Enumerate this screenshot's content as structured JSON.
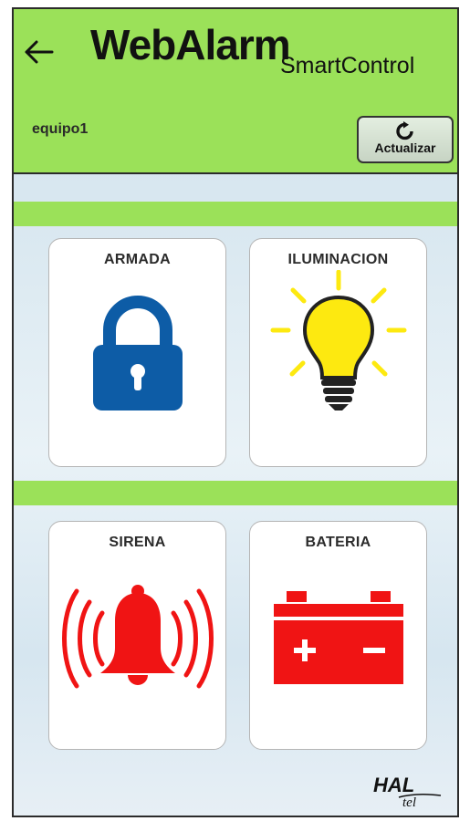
{
  "app": {
    "title": "WebAlarm",
    "subtitle": "SmartControl"
  },
  "header": {
    "device_name": "equipo1",
    "refresh_label": "Actualizar"
  },
  "cards": [
    {
      "label": "ARMADA",
      "icon": "lock-icon",
      "color": "#0d5ca6"
    },
    {
      "label": "ILUMINACION",
      "icon": "light-bulb-icon",
      "color": "#fde910"
    },
    {
      "label": "SIRENA",
      "icon": "siren-bell-icon",
      "color": "#f01414"
    },
    {
      "label": "BATERIA",
      "icon": "battery-icon",
      "color": "#f01414"
    }
  ],
  "footer": {
    "logo_text": "HAL",
    "logo_subtext": "tel"
  },
  "colors": {
    "header_green": "#9be159",
    "frame_border": "#2b2b2b"
  }
}
